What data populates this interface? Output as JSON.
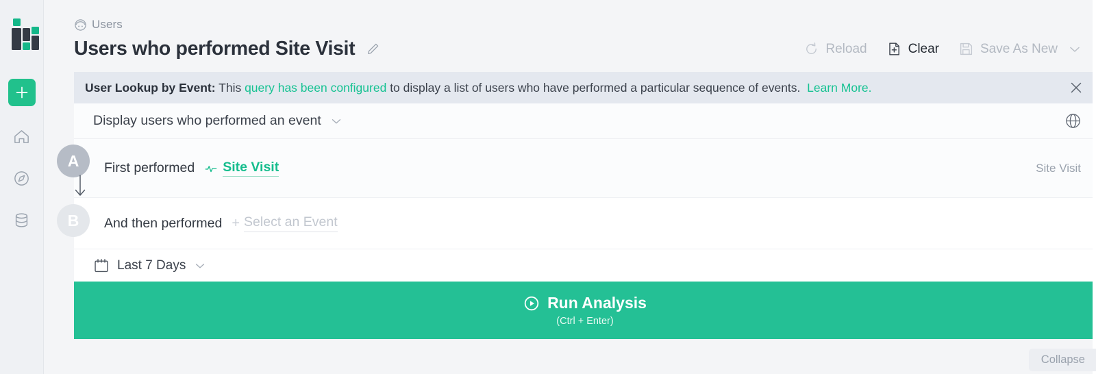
{
  "brand": {
    "accent": "#21c18c",
    "logo_name": "mixpanel-logo"
  },
  "rail": {
    "add_label": "+",
    "items": [
      {
        "name": "home-icon",
        "label": "Home"
      },
      {
        "name": "compass-icon",
        "label": "Explore"
      },
      {
        "name": "database-icon",
        "label": "Data"
      }
    ]
  },
  "header": {
    "breadcrumb": "Users",
    "title": "Users who performed Site Visit",
    "edit_icon": "pencil-icon"
  },
  "toolbar": {
    "reload_label": "Reload",
    "clear_label": "Clear",
    "save_as_new_label": "Save As New"
  },
  "banner": {
    "prefix": "User Lookup by Event:",
    "text_1": "This",
    "link_1": "query has been configured",
    "text_2": "to display a list of users who have performed a particular sequence of events.",
    "link_2": "Learn More.",
    "link_color": "#16c292",
    "close_icon": "close-icon"
  },
  "query": {
    "display_selector": "Display users who performed an event",
    "globe_icon": "globe-icon",
    "steps": [
      {
        "badge": "A",
        "label": "First performed",
        "event": "Site Visit",
        "event_icon": "activity-pulse-icon",
        "right_label": "Site Visit"
      },
      {
        "badge": "B",
        "label": "And then performed",
        "event": "Select an Event",
        "plus": "+",
        "right_label": ""
      }
    ],
    "collapse_label": "Collapse"
  },
  "date": {
    "calendar_icon": "calendar-icon",
    "range": "Last 7 Days"
  },
  "run": {
    "label": "Run Analysis",
    "shortcut": "(Ctrl + Enter)",
    "play_icon": "play-circle-icon",
    "color": "#24c095"
  }
}
